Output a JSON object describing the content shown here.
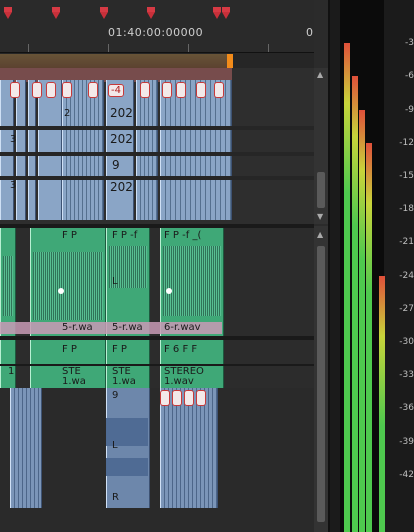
{
  "ruler": {
    "timecode": "01:40:00:00000",
    "right_edge_label": "0"
  },
  "clips": {
    "video_top": {
      "tag": "-4",
      "labels": [
        "202",
        "202",
        "9",
        "202"
      ],
      "small_labels": [
        "2",
        "3",
        "3"
      ]
    },
    "audio": {
      "clip_a_title": "F P",
      "clip_b_title": "F P -f",
      "clip_c_title": "F P -f _(",
      "channel_left": "L",
      "file_a": "5-r.wa",
      "file_b": "5-r.wa",
      "file_c": "6-r.wav",
      "row2_a": "F P",
      "row2_b": "F P",
      "row2_c": "F 6 F F",
      "row3_a": "STE",
      "row3_b": "STE",
      "row3_c": "STEREO",
      "row3_file_a": "1.wa",
      "row3_file_b": "1.wa",
      "row3_file_c": "1.wav",
      "num_left": "1"
    },
    "video_bottom": {
      "label_9": "9",
      "label_L": "L",
      "label_R": "R"
    }
  },
  "meter": {
    "scale": [
      "-3",
      "-6",
      "-9",
      "-12",
      "-15",
      "-18",
      "-21",
      "-24",
      "-27",
      "-30",
      "-33",
      "-36",
      "-39",
      "-42"
    ],
    "levels_db": [
      -3,
      -6,
      -9,
      -12,
      -24
    ],
    "colors": {
      "green": "#4ec94e",
      "yellow": "#c8d43a",
      "red": "#e0503a"
    }
  }
}
